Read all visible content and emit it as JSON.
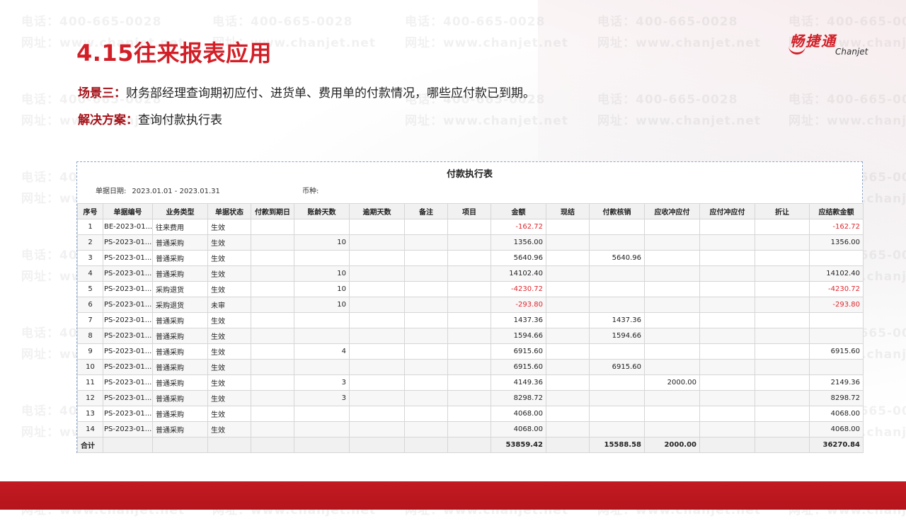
{
  "title": "4.15往来报表应用",
  "brand": {
    "name_cn": "畅捷通",
    "name_en": "Chanjet"
  },
  "scene": {
    "label": "场景三：",
    "text": "财务部经理查询期初应付、进货单、费用单的付款情况，哪些应付款已到期。",
    "solution_label": "解决方案：",
    "solution_text": "查询付款执行表"
  },
  "watermark": {
    "phone": "电话：400-665-0028",
    "site": "网址：www.chanjet.net"
  },
  "report": {
    "title": "付款执行表",
    "date_label": "单据日期:",
    "date_value": "2023.01.01 - 2023.01.31",
    "currency_label": "币种:",
    "columns": [
      "序号",
      "单据编号",
      "业务类型",
      "单据状态",
      "付款到期日",
      "账龄天数",
      "逾期天数",
      "备注",
      "项目",
      "金额",
      "现结",
      "付款核销",
      "应收冲应付",
      "应付冲应付",
      "折让",
      "应结款金额"
    ],
    "rows": [
      [
        "1",
        "BE-2023-01...",
        "往来费用",
        "生效",
        "",
        "",
        "",
        "",
        "",
        "-162.72",
        "",
        "",
        "",
        "",
        "",
        "-162.72"
      ],
      [
        "2",
        "PS-2023-01...",
        "普通采购",
        "生效",
        "",
        "10",
        "",
        "",
        "",
        "1356.00",
        "",
        "",
        "",
        "",
        "",
        "1356.00"
      ],
      [
        "3",
        "PS-2023-01...",
        "普通采购",
        "生效",
        "",
        "",
        "",
        "",
        "",
        "5640.96",
        "",
        "5640.96",
        "",
        "",
        "",
        ""
      ],
      [
        "4",
        "PS-2023-01...",
        "普通采购",
        "生效",
        "",
        "10",
        "",
        "",
        "",
        "14102.40",
        "",
        "",
        "",
        "",
        "",
        "14102.40"
      ],
      [
        "5",
        "PS-2023-01...",
        "采购退货",
        "生效",
        "",
        "10",
        "",
        "",
        "",
        "-4230.72",
        "",
        "",
        "",
        "",
        "",
        "-4230.72"
      ],
      [
        "6",
        "PS-2023-01...",
        "采购退货",
        "未审",
        "",
        "10",
        "",
        "",
        "",
        "-293.80",
        "",
        "",
        "",
        "",
        "",
        "-293.80"
      ],
      [
        "7",
        "PS-2023-01...",
        "普通采购",
        "生效",
        "",
        "",
        "",
        "",
        "",
        "1437.36",
        "",
        "1437.36",
        "",
        "",
        "",
        ""
      ],
      [
        "8",
        "PS-2023-01...",
        "普通采购",
        "生效",
        "",
        "",
        "",
        "",
        "",
        "1594.66",
        "",
        "1594.66",
        "",
        "",
        "",
        ""
      ],
      [
        "9",
        "PS-2023-01...",
        "普通采购",
        "生效",
        "",
        "4",
        "",
        "",
        "",
        "6915.60",
        "",
        "",
        "",
        "",
        "",
        "6915.60"
      ],
      [
        "10",
        "PS-2023-01...",
        "普通采购",
        "生效",
        "",
        "",
        "",
        "",
        "",
        "6915.60",
        "",
        "6915.60",
        "",
        "",
        "",
        ""
      ],
      [
        "11",
        "PS-2023-01...",
        "普通采购",
        "生效",
        "",
        "3",
        "",
        "",
        "",
        "4149.36",
        "",
        "",
        "2000.00",
        "",
        "",
        "2149.36"
      ],
      [
        "12",
        "PS-2023-01...",
        "普通采购",
        "生效",
        "",
        "3",
        "",
        "",
        "",
        "8298.72",
        "",
        "",
        "",
        "",
        "",
        "8298.72"
      ],
      [
        "13",
        "PS-2023-01...",
        "普通采购",
        "生效",
        "",
        "",
        "",
        "",
        "",
        "4068.00",
        "",
        "",
        "",
        "",
        "",
        "4068.00"
      ],
      [
        "14",
        "PS-2023-01...",
        "普通采购",
        "生效",
        "",
        "",
        "",
        "",
        "",
        "4068.00",
        "",
        "",
        "",
        "",
        "",
        "4068.00"
      ]
    ],
    "total": [
      "合计",
      "",
      "",
      "",
      "",
      "",
      "",
      "",
      "",
      "53859.42",
      "",
      "15588.58",
      "2000.00",
      "",
      "",
      "36270.84"
    ]
  },
  "colors": {
    "brand_red": "#d21f27",
    "negative": "#e0262d",
    "scene_label": "#a5131a"
  }
}
